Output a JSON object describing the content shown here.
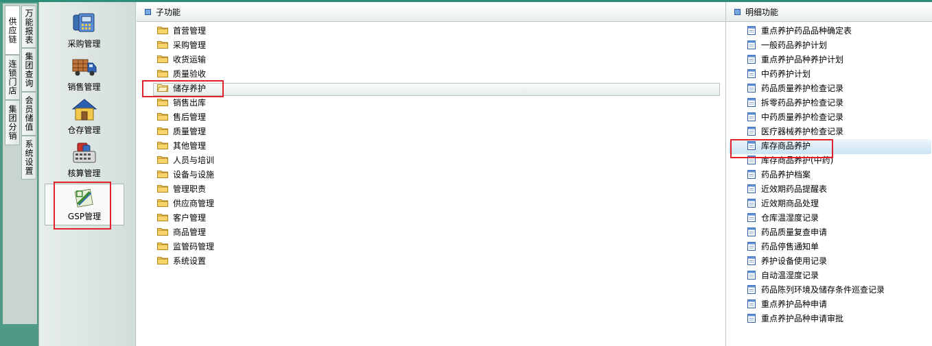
{
  "side_tabs": {
    "supply_chain": "供应链",
    "chain_store": "连锁门店",
    "group_distribution": "集团分销",
    "universal_report": "万能报表",
    "group_query": "集团查询",
    "member_stored_value": "会员储值",
    "system_settings": "系统设置"
  },
  "modules": [
    {
      "label": "采购管理",
      "icon": "purchase-icon"
    },
    {
      "label": "销售管理",
      "icon": "truck-icon"
    },
    {
      "label": "仓存管理",
      "icon": "warehouse-icon"
    },
    {
      "label": "核算管理",
      "icon": "calculator-icon"
    },
    {
      "label": "GSP管理",
      "icon": "gsp-icon"
    }
  ],
  "sub_function": {
    "title": "子功能",
    "items": [
      "首营管理",
      "采购管理",
      "收货运输",
      "质量验收",
      "储存养护",
      "销售出库",
      "售后管理",
      "质量管理",
      "其他管理",
      "人员与培训",
      "设备与设施",
      "管理职责",
      "供应商管理",
      "客户管理",
      "商品管理",
      "监管码管理",
      "系统设置"
    ],
    "selected": "储存养护"
  },
  "detail_function": {
    "title": "明细功能",
    "items": [
      "重点养护药品品种确定表",
      "一般药品养护计划",
      "重点养护品种养护计划",
      "中药养护计划",
      "药品质量养护检查记录",
      "拆零药品养护检查记录",
      "中药质量养护检查记录",
      "医疗器械养护检查记录",
      "库存商品养护",
      "库存商品养护(中药)",
      "药品养护档案",
      "近效期药品提醒表",
      "近效期商品处理",
      "仓库温湿度记录",
      "药品质量复查申请",
      "药品停售通知单",
      "养护设备使用记录",
      "自动温湿度记录",
      "药品陈列环境及储存条件巡查记录",
      "重点养护品种申请",
      "重点养护品种申请审批"
    ],
    "selected": "库存商品养护"
  },
  "colors": {
    "frame_green": "#4f9a84",
    "highlight_red": "#e0202a",
    "selection_blue": "#c9e4f3"
  }
}
